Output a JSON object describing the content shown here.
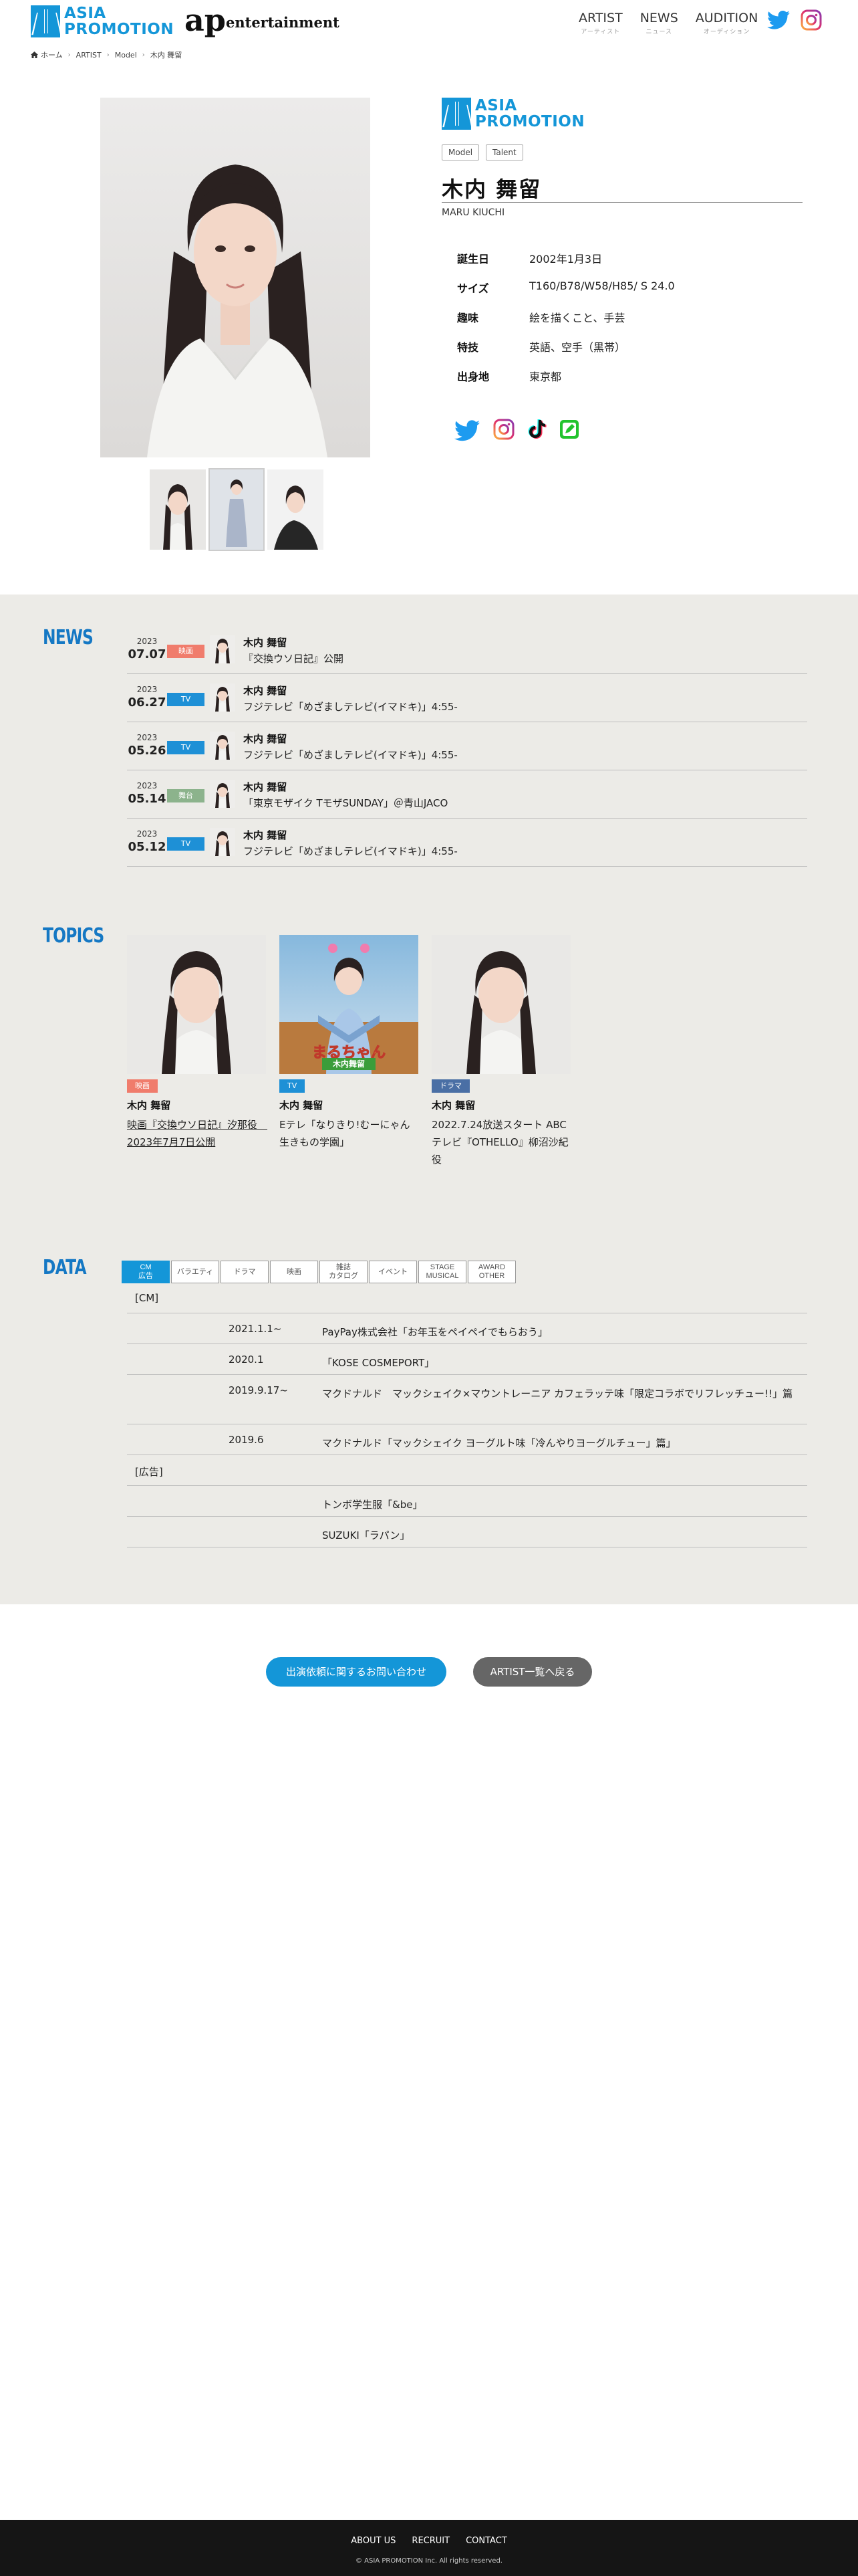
{
  "header": {
    "logo_line1": "ASIA",
    "logo_line2": "PROMOTION",
    "ent_ap": "ap",
    "ent_word": "entertainment",
    "nav": [
      {
        "main": "ARTIST",
        "sub": "アーティスト"
      },
      {
        "main": "NEWS",
        "sub": "ニュース"
      },
      {
        "main": "AUDITION",
        "sub": "オーディション"
      }
    ],
    "icons": [
      "twitter-icon",
      "instagram-icon"
    ]
  },
  "breadcrumb": [
    "ホーム",
    "ARTIST",
    "Model",
    "木内 舞留"
  ],
  "profile": {
    "tags": [
      "Model",
      "Talent"
    ],
    "name_jp": "木内 舞留",
    "name_en": "MARU KIUCHI",
    "rows": [
      {
        "k": "誕生日",
        "v": "2002年1月3日"
      },
      {
        "k": "サイズ",
        "v": "T160/B78/W58/H85/ S 24.0"
      },
      {
        "k": "趣味",
        "v": "絵を描くこと、手芸"
      },
      {
        "k": "特技",
        "v": "英語、空手（黒帯）"
      },
      {
        "k": "出身地",
        "v": "東京都"
      }
    ],
    "sns": [
      "twitter-icon",
      "instagram-icon",
      "tiktok-icon",
      "blog-icon"
    ]
  },
  "news": {
    "title": "NEWS",
    "items": [
      {
        "year": "2023",
        "date": "07.07",
        "badge": "映画",
        "badge_color": "#f07c6c",
        "name": "木内 舞留",
        "title": "『交換ウソ日記』公開"
      },
      {
        "year": "2023",
        "date": "06.27",
        "badge": "TV",
        "badge_color": "#1e90d6",
        "name": "木内 舞留",
        "title": "フジテレビ「めざましテレビ(イマドキ)」4:55-"
      },
      {
        "year": "2023",
        "date": "05.26",
        "badge": "TV",
        "badge_color": "#1e90d6",
        "name": "木内 舞留",
        "title": "フジテレビ「めざましテレビ(イマドキ)」4:55-"
      },
      {
        "year": "2023",
        "date": "05.14",
        "badge": "舞台",
        "badge_color": "#8cb38c",
        "name": "木内 舞留",
        "title": "「東京モザイク TモザSUNDAY」＠青山JACO"
      },
      {
        "year": "2023",
        "date": "05.12",
        "badge": "TV",
        "badge_color": "#1e90d6",
        "name": "木内 舞留",
        "title": "フジテレビ「めざましテレビ(イマドキ)」4:55-"
      }
    ]
  },
  "topics": {
    "title": "TOPICS",
    "items": [
      {
        "badge": "映画",
        "badge_color": "#f07c6c",
        "name": "木内 舞留",
        "text": "映画『交換ウソ日記』汐那役　2023年7月7日公開",
        "link": true
      },
      {
        "badge": "TV",
        "badge_color": "#1e90d6",
        "name": "木内 舞留",
        "text": "Eテレ「なりきり!むーにゃん生きもの学園」",
        "link": false,
        "overlay_line1": "まるちゃん",
        "overlay_line2": "木内舞留"
      },
      {
        "badge": "ドラマ",
        "badge_color": "#4a6fa5",
        "name": "木内 舞留",
        "text": "2022.7.24放送スタート ABCテレビ『OTHELLO』柳沼沙紀役",
        "link": false
      }
    ]
  },
  "data": {
    "title": "DATA",
    "tabs": [
      "CM\n広告",
      "バラエティ",
      "ドラマ",
      "映画",
      "雑誌\nカタログ",
      "イベント",
      "STAGE\nMUSICAL",
      "AWARD\nOTHER"
    ],
    "rows": [
      {
        "group": "[CM]",
        "year": "",
        "text": ""
      },
      {
        "group": "",
        "year": "2021.1.1~",
        "text": "PayPay株式会社「お年玉をペイペイでもらおう」"
      },
      {
        "group": "",
        "year": "2020.1",
        "text": "「KOSE COSMEPORT」"
      },
      {
        "group": "",
        "year": "2019.9.17~",
        "text": "マクドナルド　マックシェイク×マウントレーニア カフェラッテ味「限定コラボでリフレッチュー!!」篇"
      },
      {
        "group": "",
        "year": "2019.6",
        "text": "マクドナルド「マックシェイク ヨーグルト味「冷んやりヨーグルチュー」篇」"
      },
      {
        "group": "[広告]",
        "year": "",
        "text": ""
      },
      {
        "group": "",
        "year": "",
        "text": "トンボ学生服「&be」"
      },
      {
        "group": "",
        "year": "",
        "text": "SUZUKI「ラパン」"
      }
    ]
  },
  "buttons": {
    "contact": "出演依頼に関するお問い合わせ",
    "back": "ARTIST一覧へ戻る",
    "contact_color": "#1496d8",
    "back_color": "#666666"
  },
  "footer": {
    "links": [
      "ABOUT US",
      "RECRUIT",
      "CONTACT"
    ],
    "copyright": "© ASIA PROMOTION Inc. All rights reserved."
  }
}
